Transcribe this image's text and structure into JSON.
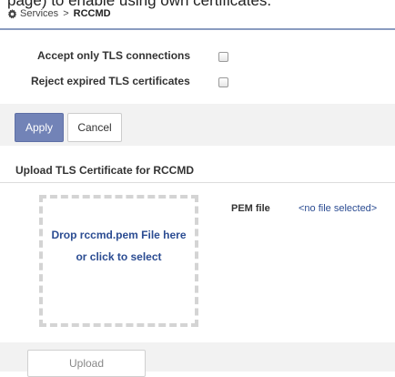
{
  "intro_text": "page) to enable using own certificates.",
  "breadcrumb": {
    "icon": "gear-icon",
    "parent": "Services",
    "separator": ">",
    "current": "RCCMD"
  },
  "options": {
    "accept_tls_label": "Accept only TLS connections",
    "accept_tls_checked": false,
    "reject_expired_label": "Reject expired TLS certificates",
    "reject_expired_checked": false
  },
  "actions": {
    "apply_label": "Apply",
    "cancel_label": "Cancel"
  },
  "upload_section": {
    "title": "Upload TLS Certificate for RCCMD",
    "drop_line1": "Drop rccmd.pem File here",
    "drop_line2": "or click to select",
    "pem_label": "PEM file",
    "pem_value": "<no file selected>",
    "upload_label": "Upload"
  },
  "colors": {
    "accent": "#7283b7",
    "link": "#2b4c92",
    "header_rule": "#8a9cc0"
  }
}
